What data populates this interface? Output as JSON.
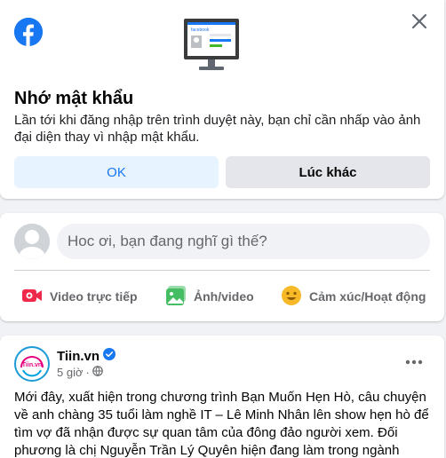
{
  "remember_prompt": {
    "title": "Nhớ mật khẩu",
    "description": "Lần tới khi đăng nhập trên trình duyệt này, bạn chỉ cần nhấp vào ảnh đại diện thay vì nhập mật khẩu.",
    "ok_label": "OK",
    "later_label": "Lúc khác",
    "monitor_brand": "facebook",
    "icons": {
      "logo": "facebook-logo-icon",
      "close": "close-icon",
      "illustration": "monitor-illustration-icon"
    }
  },
  "composer": {
    "placeholder": "Hoc ơi, bạn đang nghĩ gì thế?",
    "actions": [
      {
        "label": "Video trực tiếp",
        "icon": "live-video-icon",
        "color": "#f02849"
      },
      {
        "label": "Ảnh/video",
        "icon": "photo-video-icon",
        "color": "#45bd62"
      },
      {
        "label": "Cảm xúc/Hoạt động",
        "icon": "feeling-activity-icon",
        "color": "#f7b928"
      }
    ]
  },
  "post": {
    "page_name": "Tiin.vn",
    "verified": true,
    "avatar_text": "Tiin.vn",
    "time": "5 giờ",
    "separator": "·",
    "audience_icon": "globe-icon",
    "text": "Mới đây, xuất hiện trong chương trình Bạn Muốn Hẹn Hò, câu chuyện về anh chàng 35 tuổi làm nghề IT – Lê Minh Nhân lên show hẹn hò để tìm vợ đã nhận được sự quan tâm của đông đảo người xem. Đối phương là chị Nguyễn Trần Lý Quyên hiện đang làm trong ngành t.hẩm m.ỹ và là mẹ đơn"
  },
  "colors": {
    "brand": "#1877f2",
    "background": "#f0f2f5",
    "secondary_text": "#65676b"
  }
}
